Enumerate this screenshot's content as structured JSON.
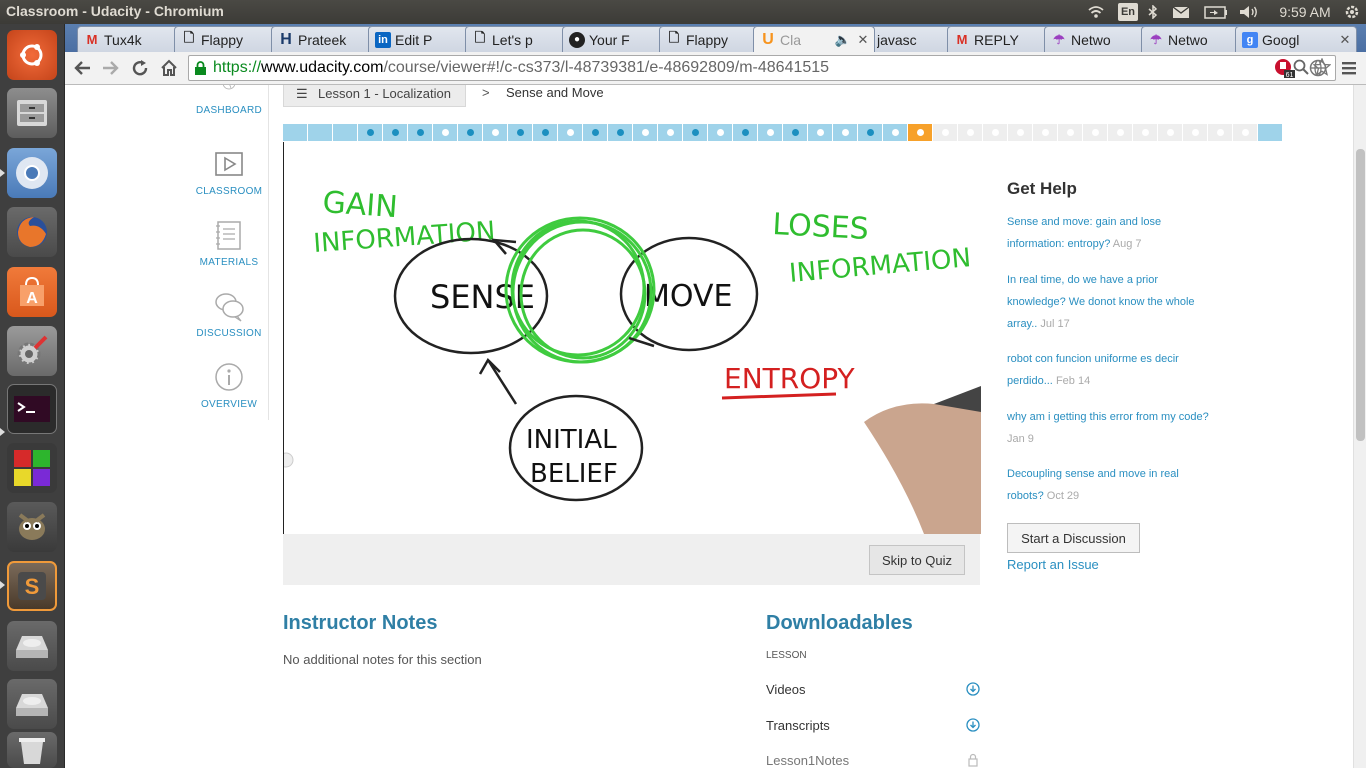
{
  "window": {
    "title": "Classroom - Udacity - Chromium"
  },
  "panel": {
    "keyboard": "En",
    "clock": "9:59 AM"
  },
  "tabs": [
    {
      "label": "Tux4k",
      "icon": "gmail-icon"
    },
    {
      "label": "Flappy",
      "icon": "document-icon"
    },
    {
      "label": "Prateek",
      "icon": "h-icon"
    },
    {
      "label": "Edit P",
      "icon": "linkedin-icon"
    },
    {
      "label": "Let's p",
      "icon": "document-icon"
    },
    {
      "label": "Your F",
      "icon": "github-icon"
    },
    {
      "label": "Flappy",
      "icon": "document-icon"
    },
    {
      "label": "Cla",
      "icon": "udacity-icon"
    },
    {
      "label": "javasc",
      "icon": "stackoverflow-icon"
    },
    {
      "label": "REPLY",
      "icon": "gmail-icon"
    },
    {
      "label": "Netwo",
      "icon": "umbrella-icon"
    },
    {
      "label": "Netwo",
      "icon": "umbrella-icon"
    },
    {
      "label": "Googl",
      "icon": "google-icon"
    }
  ],
  "omnibox": {
    "scheme": "https://",
    "host": "www.udacity.com",
    "path": "/course/viewer#!/c-cs373/l-48739381/e-48692809/m-48641515",
    "extension_badge": "61"
  },
  "nav": {
    "dashboard": "DASHBOARD",
    "classroom": "CLASSROOM",
    "materials": "MATERIALS",
    "discussion": "DISCUSSION",
    "overview": "OVERVIEW"
  },
  "breadcrumb": {
    "lesson": "Lesson 1 - Localization",
    "separator": ">",
    "current": "Sense and Move"
  },
  "progress": {
    "segments": [
      "e",
      "e",
      "e",
      "v",
      "v",
      "v",
      "q",
      "v",
      "q",
      "v",
      "v",
      "q",
      "v",
      "v",
      "q",
      "q",
      "v",
      "q",
      "v",
      "q",
      "v",
      "q",
      "q",
      "v",
      "q",
      "cur",
      "n",
      "n",
      "n",
      "n",
      "n",
      "n",
      "n",
      "n",
      "n",
      "n",
      "n",
      "n",
      "n"
    ],
    "colors": {
      "done": "#9fd3ea",
      "dot_video": "#1b8fc0",
      "dot_quiz": "#ffffff",
      "current": "#f7a12a",
      "todo": "#eeeeee"
    }
  },
  "video": {
    "gain_line1": "GAIN",
    "gain_line2": "INFORMATION",
    "loses_line1": "LOSES",
    "loses_line2": "INFORMATION",
    "sense": "SENSE",
    "move": "MOVE",
    "entropy": "ENTROPY",
    "initial_line1": "INITIAL",
    "initial_line2": "BELIEF"
  },
  "skip_quiz": "Skip to Quiz",
  "help": {
    "title": "Get Help",
    "links": [
      {
        "text": "Sense and move: gain and lose information: entropy?",
        "date": "Aug 7"
      },
      {
        "text": "In real time, do we have a prior knowledge? We donot know the whole array..",
        "date": "Jul 17"
      },
      {
        "text": "robot con funcion uniforme es decir perdido...",
        "date": "Feb 14"
      },
      {
        "text": "why am i getting this error from my code?",
        "date": "Jan 9"
      },
      {
        "text": "Decoupling sense and move in real robots?",
        "date": "Oct 29"
      }
    ],
    "start_discussion": "Start a Discussion",
    "report_issue": "Report an Issue"
  },
  "instructor_notes": {
    "title": "Instructor Notes",
    "body": "No additional notes for this section"
  },
  "downloadables": {
    "title": "Downloadables",
    "section": "LESSON",
    "items": [
      "Videos",
      "Transcripts",
      "Lesson1Notes"
    ]
  }
}
